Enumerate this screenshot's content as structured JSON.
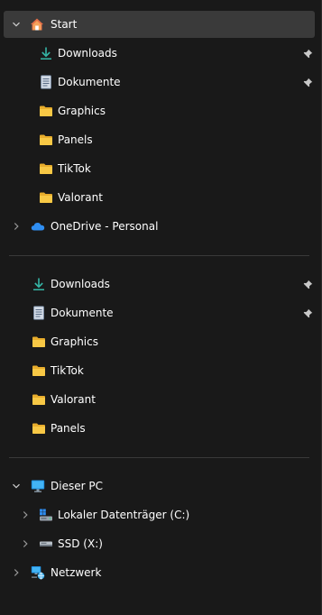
{
  "nav": {
    "quick_access": {
      "label": "Start",
      "expanded": true,
      "items": [
        {
          "label": "Downloads",
          "icon": "download-icon",
          "pinned": true
        },
        {
          "label": "Dokumente",
          "icon": "document-icon",
          "pinned": true
        },
        {
          "label": "Graphics",
          "icon": "folder-icon",
          "pinned": false
        },
        {
          "label": "Panels",
          "icon": "folder-icon",
          "pinned": false
        },
        {
          "label": "TikTok",
          "icon": "folder-icon",
          "pinned": false
        },
        {
          "label": "Valorant",
          "icon": "folder-icon",
          "pinned": false
        }
      ]
    },
    "onedrive": {
      "label": "OneDrive - Personal",
      "icon": "cloud-icon"
    },
    "pinned_section": {
      "items": [
        {
          "label": "Downloads",
          "icon": "download-icon",
          "pinned": true
        },
        {
          "label": "Dokumente",
          "icon": "document-icon",
          "pinned": true
        },
        {
          "label": "Graphics",
          "icon": "folder-icon"
        },
        {
          "label": "TikTok",
          "icon": "folder-icon"
        },
        {
          "label": "Valorant",
          "icon": "folder-icon"
        },
        {
          "label": "Panels",
          "icon": "folder-icon"
        }
      ]
    },
    "this_pc": {
      "label": "Dieser PC",
      "icon": "computer-icon",
      "children": [
        {
          "label": "Lokaler Datenträger (C:)",
          "icon": "windows-drive-icon"
        },
        {
          "label": "SSD (X:)",
          "icon": "ssd-icon"
        }
      ]
    },
    "network": {
      "label": "Netzwerk",
      "icon": "network-icon"
    }
  },
  "colors": {
    "background": "#191919",
    "selected": "#3a3a3a",
    "folder": "#f8c845",
    "download": "#35b6a6",
    "onedrive": "#2f8ef2"
  }
}
